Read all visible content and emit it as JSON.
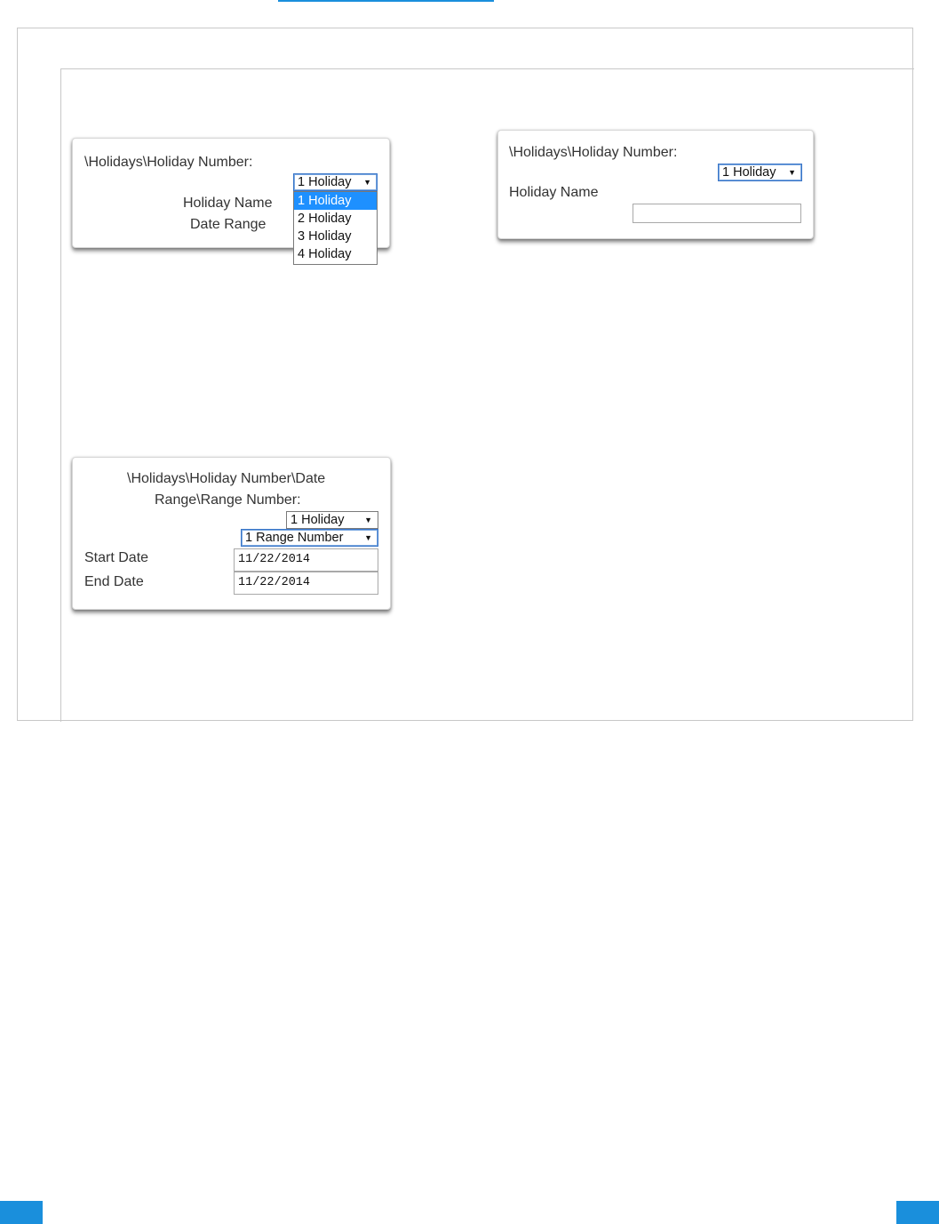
{
  "panel1": {
    "heading": "\\Holidays\\Holiday Number:",
    "select_value": "1 Holiday",
    "label_name": "Holiday Name",
    "label_range": "Date Range",
    "options": [
      "1 Holiday",
      "2 Holiday",
      "3 Holiday",
      "4 Holiday"
    ]
  },
  "panel2": {
    "heading": "\\Holidays\\Holiday Number:",
    "select_value": "1 Holiday",
    "label_name": "Holiday Name",
    "name_value": ""
  },
  "panel3": {
    "heading_line1": "\\Holidays\\Holiday Number\\Date",
    "heading_line2": "Range\\Range Number:",
    "select_holiday": "1 Holiday",
    "select_range": "1 Range Number",
    "label_start": "Start Date",
    "start_value": "11/22/2014",
    "label_end": "End Date",
    "end_value": "11/22/2014"
  },
  "icons": {
    "dropdown_arrow": "▼"
  },
  "colors": {
    "accent": "#1a8fdc",
    "selected_option": "#1e90ff"
  }
}
